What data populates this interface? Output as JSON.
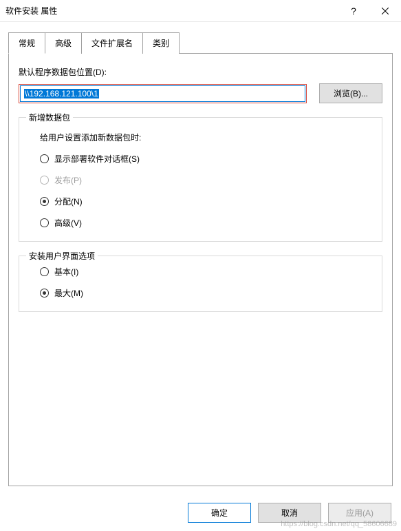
{
  "title": "软件安装 属性",
  "titlebar": {
    "help": "?",
    "close": "×"
  },
  "tabs": {
    "general": "常规",
    "advanced": "高级",
    "ext": "文件扩展名",
    "category": "类别"
  },
  "default_loc": {
    "label": "默认程序数据包位置(D):",
    "value": "\\\\192.168.121.100\\1",
    "browse": "浏览(B)..."
  },
  "new_pkg": {
    "legend": "新增数据包",
    "desc": "给用户设置添加新数据包时:",
    "opt_dialog": "显示部署软件对话框(S)",
    "opt_publish": "发布(P)",
    "opt_assign": "分配(N)",
    "opt_advanced": "高级(V)"
  },
  "ui_opts": {
    "legend": "安装用户界面选项",
    "opt_basic": "基本(I)",
    "opt_max": "最大(M)"
  },
  "buttons": {
    "ok": "确定",
    "cancel": "取消",
    "apply": "应用(A)"
  },
  "watermark": "https://blog.csdn.net/qq_58606689"
}
